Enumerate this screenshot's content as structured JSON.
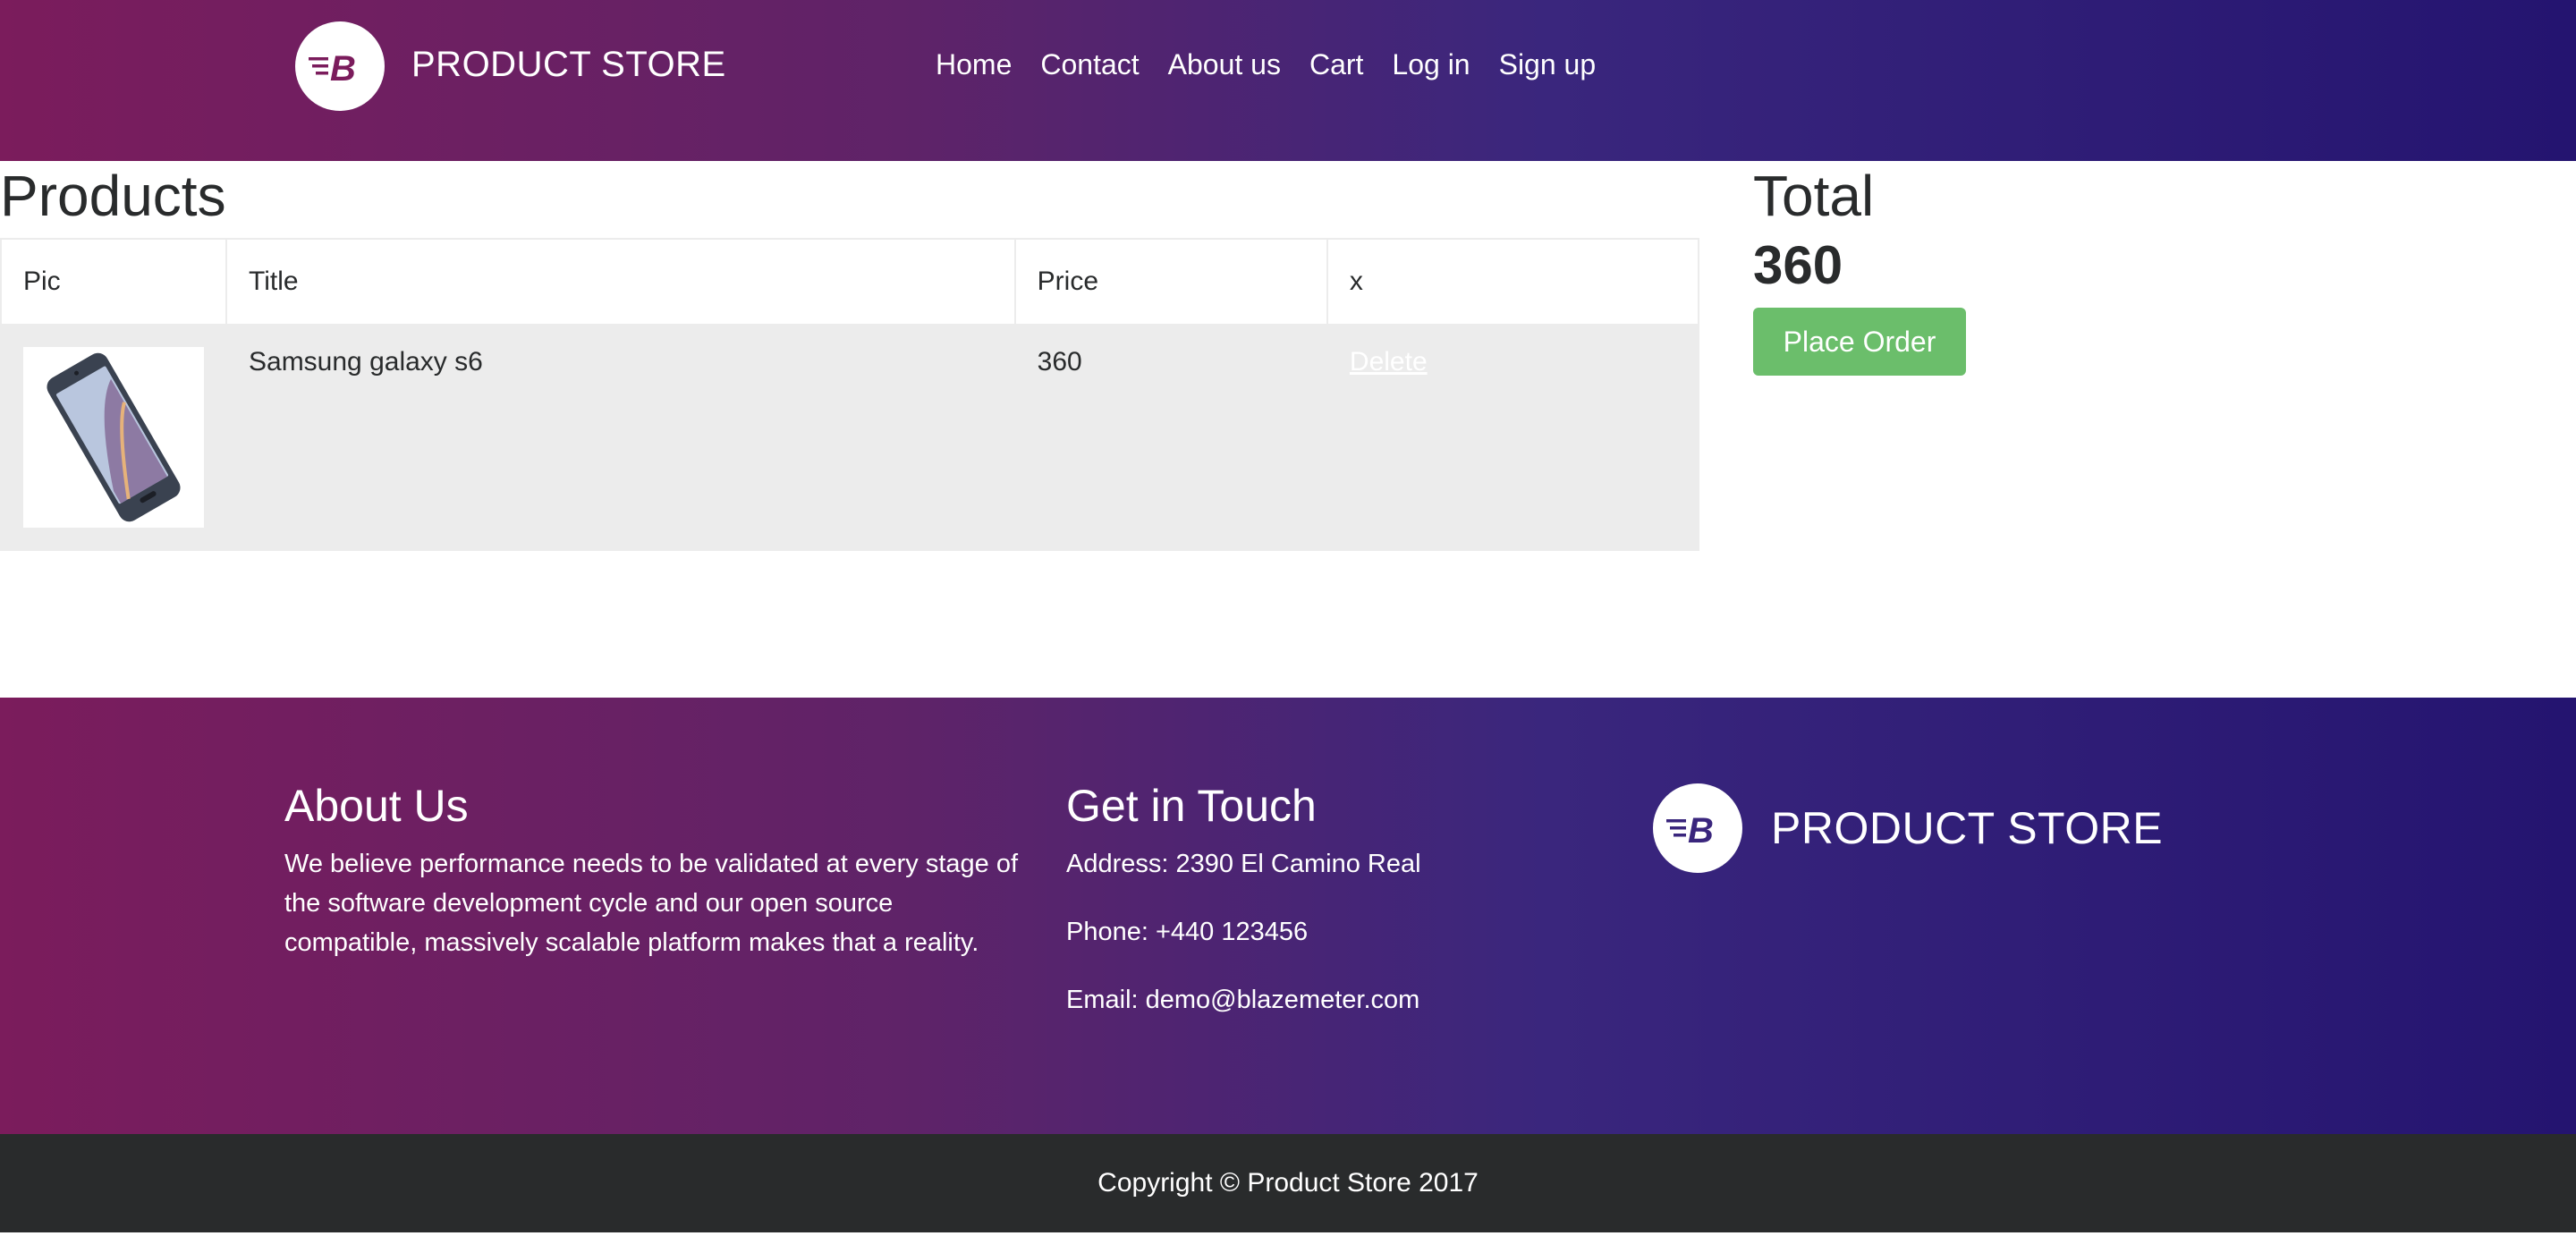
{
  "navbar": {
    "brand": "PRODUCT STORE",
    "links": [
      "Home",
      "Contact",
      "About us",
      "Cart",
      "Log in",
      "Sign up"
    ]
  },
  "products": {
    "title": "Products",
    "columns": [
      "Pic",
      "Title",
      "Price",
      "x"
    ],
    "rows": [
      {
        "title": "Samsung galaxy s6",
        "price": "360",
        "action": "Delete"
      }
    ]
  },
  "total": {
    "title": "Total",
    "value": "360",
    "place_order": "Place Order"
  },
  "footer": {
    "about_title": "About Us",
    "about_text": "We believe performance needs to be validated at every stage of the software development cycle and our open source compatible, massively scalable platform makes that a reality.",
    "touch_title": "Get in Touch",
    "address": "Address: 2390 El Camino Real",
    "phone": "Phone: +440 123456",
    "email": "Email: demo@blazemeter.com",
    "brand": "PRODUCT STORE"
  },
  "copyright": "Copyright © Product Store 2017",
  "colors": {
    "gradient_start": "#7b1c5c",
    "gradient_end": "#241470",
    "order_button": "#5cb85c",
    "copyright_bg": "#292b2c"
  }
}
